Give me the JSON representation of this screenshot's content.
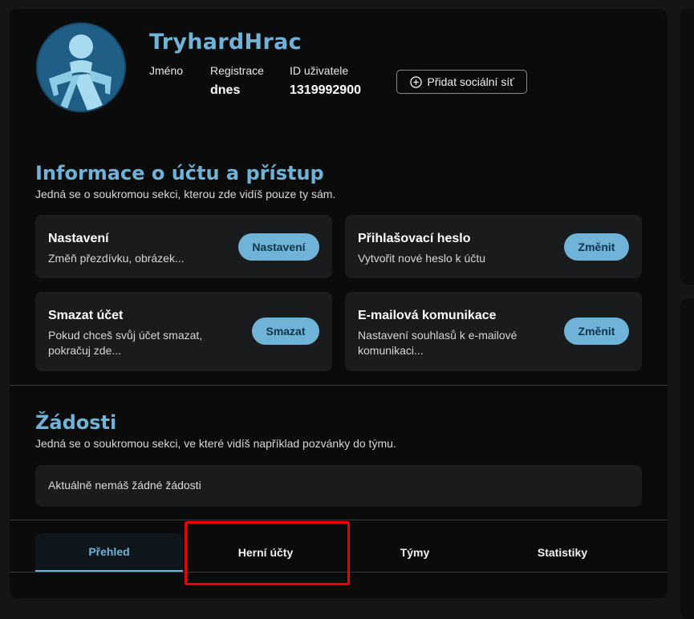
{
  "profile": {
    "username": "TryhardHrac",
    "labels": {
      "name": "Jméno",
      "registration": "Registrace",
      "user_id": "ID uživatele"
    },
    "values": {
      "registration": "dnes",
      "user_id": "1319992900"
    },
    "add_social_label": "Přidat sociální síť"
  },
  "account": {
    "title": "Informace o účtu a přístup",
    "subtitle": "Jedná se o soukromou sekci, kterou zde vidíš pouze ty sám.",
    "cards": [
      {
        "title": "Nastavení",
        "desc": "Změň přezdívku, obrázek...",
        "button": "Nastavení"
      },
      {
        "title": "Přihlašovací heslo",
        "desc": "Vytvořit nové heslo k účtu",
        "button": "Změnit"
      },
      {
        "title": "Smazat účet",
        "desc": "Pokud chceš svůj účet smazat, pokračuj zde...",
        "button": "Smazat"
      },
      {
        "title": "E-mailová komunikace",
        "desc": "Nastavení souhlasů k e-mailové komunikaci...",
        "button": "Změnit"
      }
    ]
  },
  "requests": {
    "title": "Žádosti",
    "subtitle": "Jedná se o soukromou sekci, ve které vidíš například pozvánky do týmu.",
    "empty_text": "Aktuálně nemáš žádné žádosti"
  },
  "tabs": [
    {
      "label": "Přehled",
      "active": true
    },
    {
      "label": "Herní účty",
      "active": false
    },
    {
      "label": "Týmy",
      "active": false
    },
    {
      "label": "Statistiky",
      "active": false
    }
  ],
  "colors": {
    "accent": "#6fb3d8",
    "panel": "#0b0b0c",
    "card": "#1a1b1d",
    "highlight": "#f00000"
  }
}
